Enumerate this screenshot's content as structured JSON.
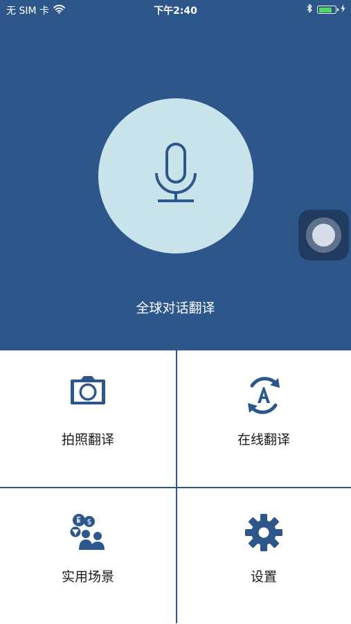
{
  "status_bar": {
    "carrier": "无 SIM 卡",
    "time": "下午2:40",
    "battery_level": 0.85,
    "icons": [
      "wifi-icon",
      "bluetooth-icon",
      "battery-icon",
      "charging-bolt-icon"
    ]
  },
  "main": {
    "label": "全球对话翻译",
    "icon": "microphone-icon"
  },
  "tiles": [
    {
      "label": "拍照翻译",
      "icon": "camera-icon"
    },
    {
      "label": "在线翻译",
      "icon": "refresh-translate-icon"
    },
    {
      "label": "实用场景",
      "icon": "scenes-people-icon"
    },
    {
      "label": "设置",
      "icon": "gear-icon"
    }
  ],
  "colors": {
    "primary": "#2d578b",
    "mic_circle": "#c9e3ea",
    "battery": "#4cd964"
  }
}
